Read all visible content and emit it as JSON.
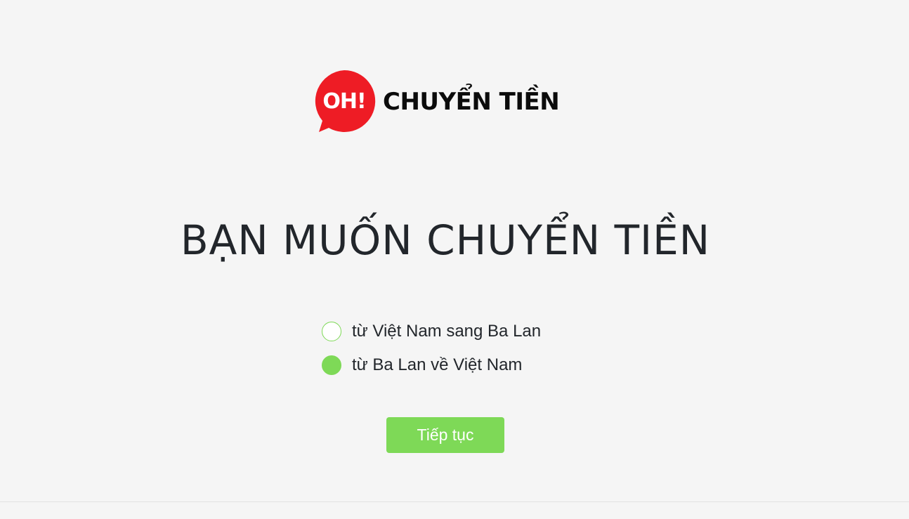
{
  "logo": {
    "badge_text": "OH!",
    "wordmark": "CHUYỂN TIỀN",
    "badge_color": "#ee1c25"
  },
  "headline": "BẠN MUỐN CHUYỂN TIỀN",
  "options": [
    {
      "label": "từ Việt Nam sang Ba Lan",
      "selected": false
    },
    {
      "label": "từ Ba Lan về Việt Nam",
      "selected": true
    }
  ],
  "continue_label": "Tiếp tục",
  "colors": {
    "accent": "#7ed957",
    "background": "#f5f5f5",
    "text": "#22262b"
  }
}
